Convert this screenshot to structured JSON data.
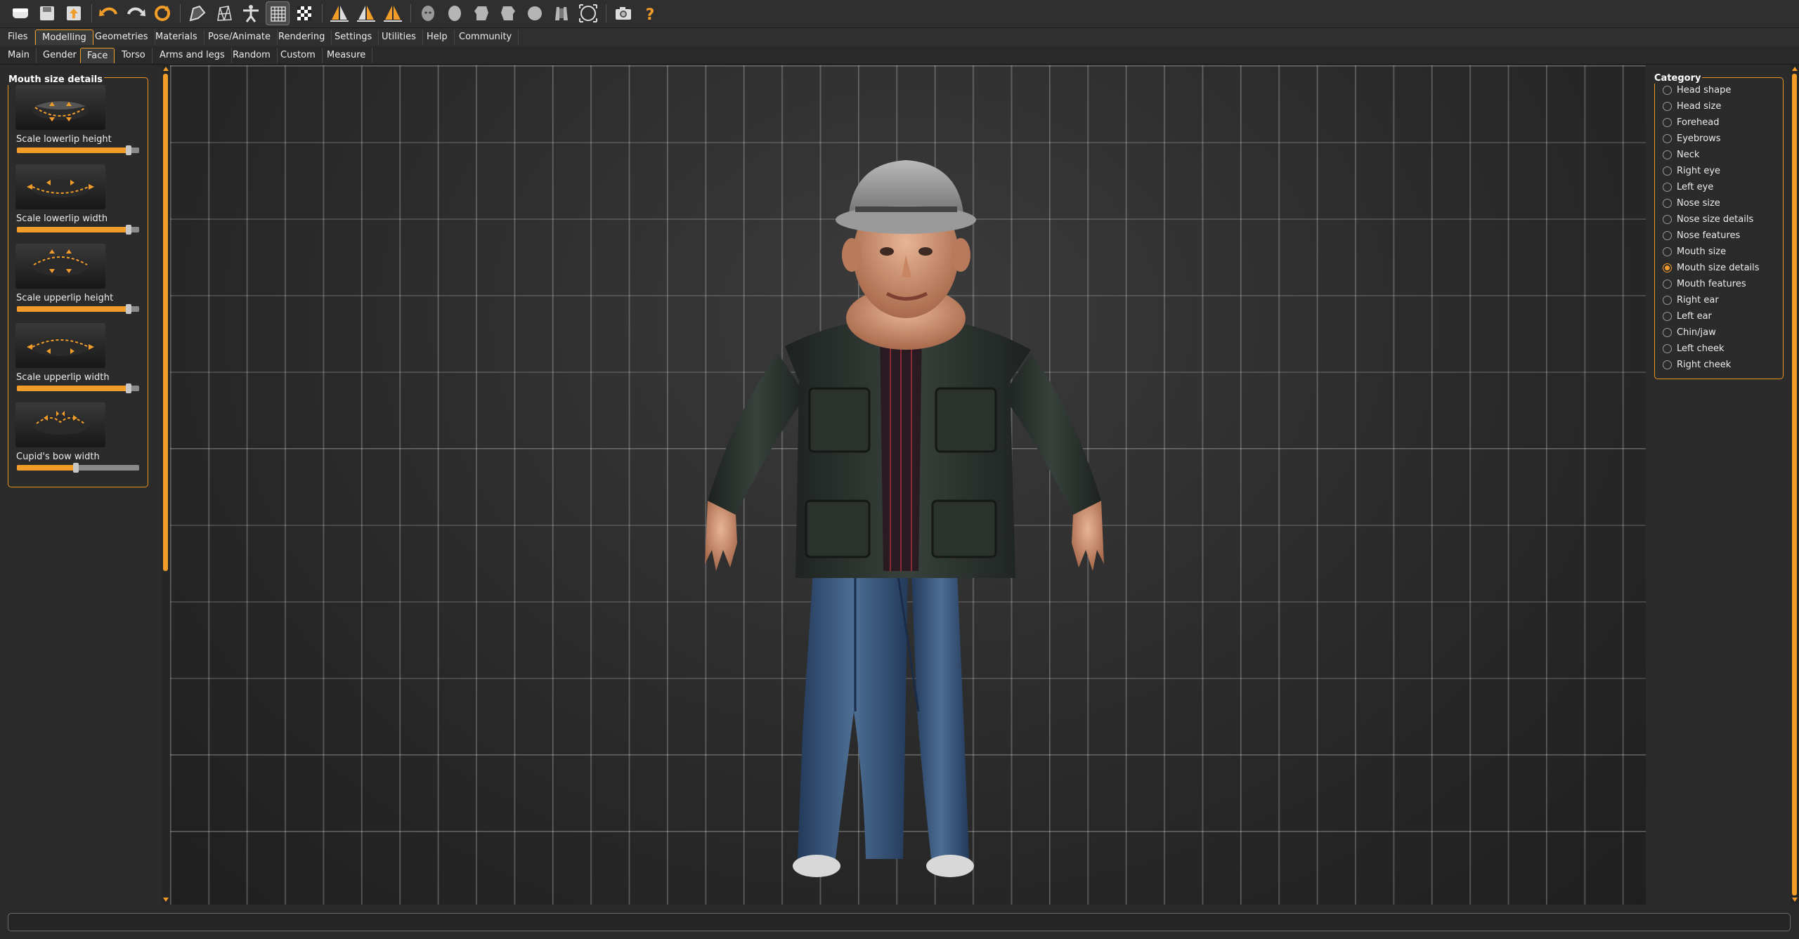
{
  "toolbar": {
    "icons": [
      "undo-icon",
      "redo-icon",
      "reset-icon",
      "smooth-icon",
      "wireframe-icon",
      "pose-icon",
      "grid-icon",
      "checker-icon",
      "symmetry-right-icon",
      "symmetry-left-icon",
      "symmetry-icon",
      "front-view-icon",
      "back-view-icon",
      "left-view-icon",
      "right-view-icon",
      "top-view-icon",
      "bottom-view-icon",
      "reset-camera-icon",
      "screenshot-icon",
      "help-icon"
    ]
  },
  "menu": {
    "items": [
      "Files",
      "Modelling",
      "Geometries",
      "Materials",
      "Pose/Animate",
      "Rendering",
      "Settings",
      "Utilities",
      "Help",
      "Community"
    ],
    "active": "Modelling"
  },
  "subtabs": {
    "items": [
      "Main",
      "Gender",
      "Face",
      "Torso",
      "Arms and legs",
      "Random",
      "Custom",
      "Measure"
    ],
    "active": "Face"
  },
  "left_panel": {
    "title": "Mouth size details",
    "sliders": [
      {
        "label": "Scale lowerlip height",
        "value": 0.89
      },
      {
        "label": "Scale lowerlip width",
        "value": 0.89
      },
      {
        "label": "Scale upperlip height",
        "value": 0.89
      },
      {
        "label": "Scale upperlip width",
        "value": 0.89
      },
      {
        "label": "Cupid's bow width",
        "value": 0.46
      }
    ]
  },
  "right_panel": {
    "title": "Category",
    "items": [
      "Head shape",
      "Head size",
      "Forehead",
      "Eyebrows",
      "Neck",
      "Right eye",
      "Left eye",
      "Nose size",
      "Nose size details",
      "Nose features",
      "Mouth size",
      "Mouth size details",
      "Mouth features",
      "Right ear",
      "Left ear",
      "Chin/jaw",
      "Left cheek",
      "Right cheek"
    ],
    "selected": "Mouth size details"
  },
  "colors": {
    "accent": "#f29d2a",
    "background": "#2b2b2b",
    "viewport": "#2a2a2a"
  },
  "status": {
    "text": ""
  }
}
